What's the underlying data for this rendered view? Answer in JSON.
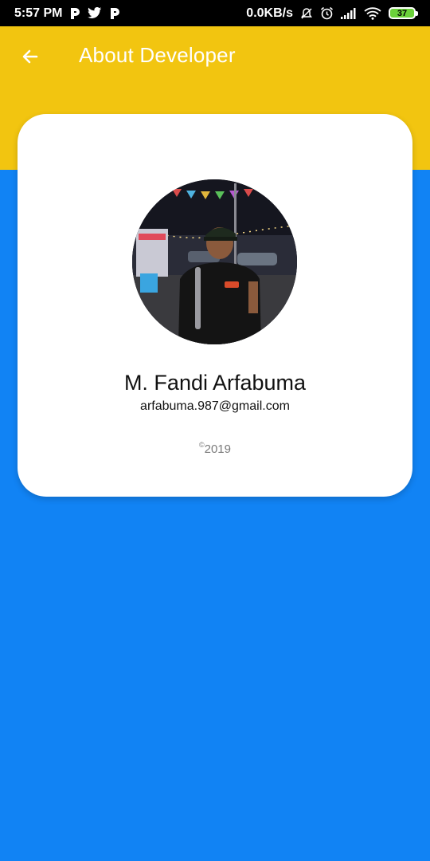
{
  "statusbar": {
    "time": "5:57 PM",
    "network_speed": "0.0KB/s",
    "battery_level": "37",
    "icons": [
      "p-app-icon",
      "twitter-icon",
      "p-app-icon",
      "mute-icon",
      "alarm-icon",
      "signal-icon",
      "wifi-icon",
      "battery-icon"
    ]
  },
  "appbar": {
    "title": "About Developer",
    "back_icon": "arrow-left-icon",
    "color": "#f2c510"
  },
  "profile": {
    "name": "M. Fandi Arfabuma",
    "email": "arfabuma.987@gmail.com",
    "copyright_symbol": "©",
    "copyright_year": "2019"
  },
  "colors": {
    "background": "#1183f4",
    "appbar": "#f2c510",
    "card": "#ffffff"
  }
}
